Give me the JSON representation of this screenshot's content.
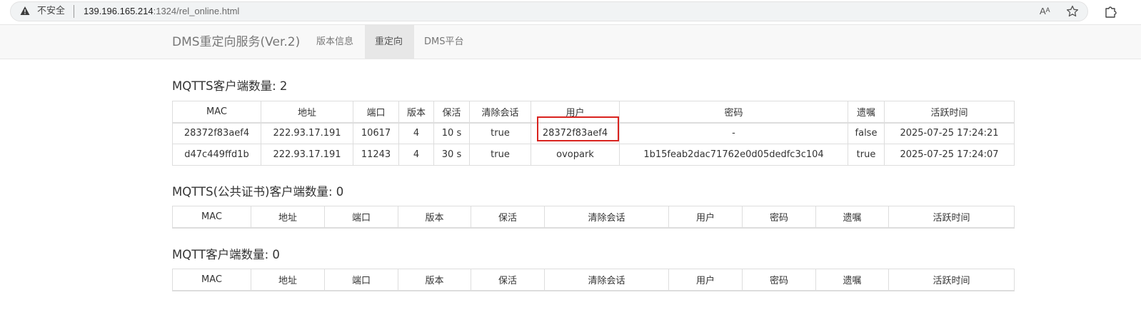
{
  "browser": {
    "insecure_label": "不安全",
    "url_host": "139.196.165.214",
    "url_rest": ":1324/rel_online.html",
    "read_aloud_glyph": "Aᴬ"
  },
  "navbar": {
    "brand": "DMS重定向服务(Ver.2)",
    "items": [
      {
        "label": "版本信息",
        "active": false
      },
      {
        "label": "重定向",
        "active": true
      },
      {
        "label": "DMS平台",
        "active": false
      }
    ]
  },
  "sections": {
    "mqtts": {
      "title": "MQTTS客户端数量: 2",
      "headers": [
        "MAC",
        "地址",
        "端口",
        "版本",
        "保活",
        "清除会话",
        "用户",
        "密码",
        "遗嘱",
        "活跃时间"
      ],
      "rows": [
        [
          "28372f83aef4",
          "222.93.17.191",
          "10617",
          "4",
          "10 s",
          "true",
          "28372f83aef4",
          "-",
          "false",
          "2025-07-25 17:24:21"
        ],
        [
          "d47c449ffd1b",
          "222.93.17.191",
          "11243",
          "4",
          "30 s",
          "true",
          "ovopark",
          "1b15feab2dac71762e0d05dedfc3c104",
          "true",
          "2025-07-25 17:24:07"
        ]
      ]
    },
    "mqtts_public": {
      "title": "MQTTS(公共证书)客户端数量: 0",
      "headers": [
        "MAC",
        "地址",
        "端口",
        "版本",
        "保活",
        "清除会话",
        "用户",
        "密码",
        "遗嘱",
        "活跃时间"
      ]
    },
    "mqtt": {
      "title": "MQTT客户端数量: 0",
      "headers": [
        "MAC",
        "地址",
        "端口",
        "版本",
        "保活",
        "清除会话",
        "用户",
        "密码",
        "遗嘱",
        "活跃时间"
      ]
    }
  },
  "colors": {
    "highlight": "#d9231f",
    "navbar_bg": "#f8f8f8",
    "active_tab_bg": "#e7e7e7"
  }
}
